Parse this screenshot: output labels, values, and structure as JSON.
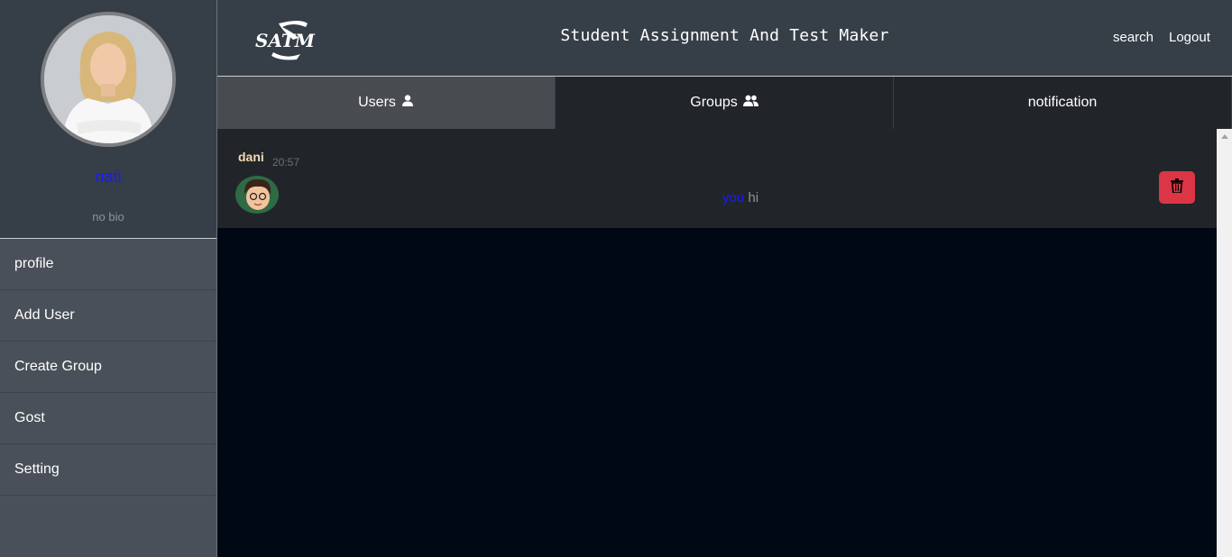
{
  "profile": {
    "name": "nati",
    "bio": "no bio"
  },
  "sidebar": {
    "items": [
      {
        "label": "profile"
      },
      {
        "label": "Add User"
      },
      {
        "label": "Create Group"
      },
      {
        "label": "Gost"
      },
      {
        "label": "Setting"
      }
    ]
  },
  "header": {
    "logo_text": "SATM",
    "title": "Student Assignment And Test Maker",
    "search_label": "search",
    "logout_label": "Logout"
  },
  "tabs": [
    {
      "label": "Users",
      "icon": "user-icon",
      "active": true
    },
    {
      "label": "Groups",
      "icon": "users-icon",
      "active": false
    },
    {
      "label": "notification",
      "active": false
    }
  ],
  "messages": [
    {
      "sender": "dani",
      "time": "20:57",
      "prefix": "you",
      "text": "hi"
    }
  ],
  "colors": {
    "danger": "#dc3545",
    "name_link": "#1a1aff",
    "sender": "#f2dcb5"
  }
}
